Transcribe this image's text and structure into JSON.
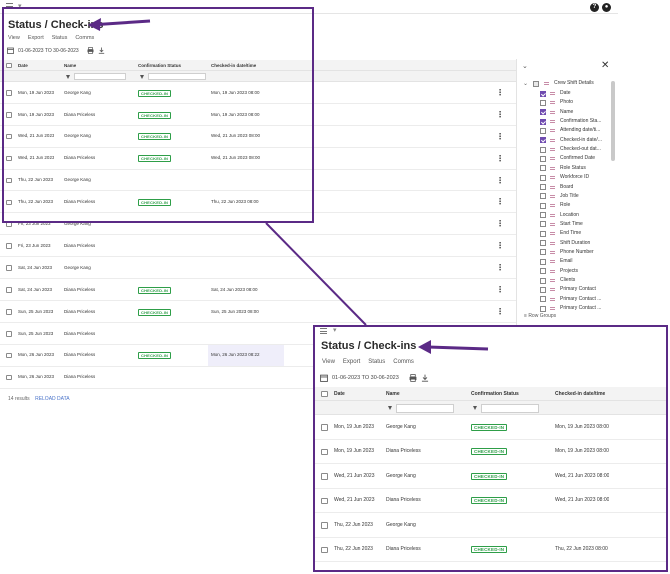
{
  "page": {
    "title": "Status / Check-ins",
    "nav": [
      "View",
      "Export",
      "Status",
      "Comms"
    ],
    "date_range": "01-06-2023 TO 30-06-2023"
  },
  "colors": {
    "accent": "#5b2a86",
    "checked_in": "#2e9e48",
    "checkbox_on": "#6f4bb0"
  },
  "grid": {
    "columns": [
      "Date",
      "Name",
      "Confirmation Status",
      "Checked-in date/time"
    ],
    "rows": [
      {
        "date": "Mon, 19 Jun 2023",
        "name": "George Kang",
        "status": "CHECKED-IN",
        "checkin": "Mon, 19 Jun 2023 08:00"
      },
      {
        "date": "Mon, 19 Jun 2023",
        "name": "Diana Priceless",
        "status": "CHECKED-IN",
        "checkin": "Mon, 19 Jun 2023 08:00"
      },
      {
        "date": "Wed, 21 Jun 2023",
        "name": "George Kang",
        "status": "CHECKED-IN",
        "checkin": "Wed, 21 Jun 2023 08:00"
      },
      {
        "date": "Wed, 21 Jun 2023",
        "name": "Diana Priceless",
        "status": "CHECKED-IN",
        "checkin": "Wed, 21 Jun 2023 08:00"
      },
      {
        "date": "Thu, 22 Jun 2023",
        "name": "George Kang",
        "status": "",
        "checkin": ""
      },
      {
        "date": "Thu, 22 Jun 2023",
        "name": "Diana Priceless",
        "status": "CHECKED-IN",
        "checkin": "Thu, 22 Jun 2023 08:00"
      },
      {
        "date": "Fri, 23 Jun 2023",
        "name": "George Kang",
        "status": "",
        "checkin": ""
      },
      {
        "date": "Fri, 23 Jun 2023",
        "name": "Diana Priceless",
        "status": "",
        "checkin": ""
      },
      {
        "date": "Sat, 24 Jun 2023",
        "name": "George Kang",
        "status": "",
        "checkin": ""
      },
      {
        "date": "Sat, 24 Jun 2023",
        "name": "Diana Priceless",
        "status": "CHECKED-IN",
        "checkin": "Sat, 24 Jun 2023 08:00"
      },
      {
        "date": "Sun, 25 Jun 2023",
        "name": "Diana Priceless",
        "status": "CHECKED-IN",
        "checkin": "Sun, 25 Jun 2023 08:00"
      },
      {
        "date": "Sun, 25 Jun 2023",
        "name": "Diana Priceless",
        "status": "",
        "checkin": ""
      },
      {
        "date": "Mon, 26 Jun 2023",
        "name": "Diana Priceless",
        "status": "CHECKED-IN",
        "checkin": "Mon, 26 Jun 2023 08:22"
      },
      {
        "date": "Mon, 26 Jun 2023",
        "name": "Diana Priceless",
        "status": "",
        "checkin": ""
      }
    ],
    "results_count": "14",
    "results_label": "results",
    "reload_label": "RELOAD DATA"
  },
  "column_panel": {
    "group_label": "Crew Shift Details",
    "row_groups_label": "Row Groups",
    "items": [
      {
        "label": "Date",
        "checked": true
      },
      {
        "label": "Photo",
        "checked": false
      },
      {
        "label": "Name",
        "checked": true
      },
      {
        "label": "Confirmation Sta...",
        "checked": true
      },
      {
        "label": "Attending date/ti...",
        "checked": false
      },
      {
        "label": "Checked-in date/...",
        "checked": true
      },
      {
        "label": "Checked-out dat...",
        "checked": false
      },
      {
        "label": "Confirmed Date",
        "checked": false
      },
      {
        "label": "Role Status",
        "checked": false
      },
      {
        "label": "Workforce ID",
        "checked": false
      },
      {
        "label": "Board",
        "checked": false
      },
      {
        "label": "Job Title",
        "checked": false
      },
      {
        "label": "Role",
        "checked": false
      },
      {
        "label": "Location",
        "checked": false
      },
      {
        "label": "Start Time",
        "checked": false
      },
      {
        "label": "End Time",
        "checked": false
      },
      {
        "label": "Shift Duration",
        "checked": false
      },
      {
        "label": "Phone Number",
        "checked": false
      },
      {
        "label": "Email",
        "checked": false
      },
      {
        "label": "Projects",
        "checked": false
      },
      {
        "label": "Clients",
        "checked": false
      },
      {
        "label": "Primary Contact",
        "checked": false
      },
      {
        "label": "Primary Contact ...",
        "checked": false
      },
      {
        "label": "Primary Contact ...",
        "checked": false
      }
    ]
  }
}
